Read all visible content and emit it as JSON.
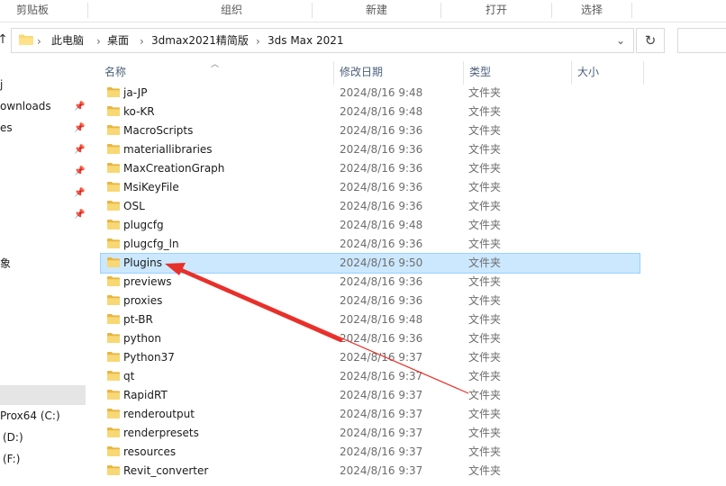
{
  "ribbon": {
    "groups": [
      "剪贴板",
      "组织",
      "新建",
      "打开",
      "选择"
    ]
  },
  "address": {
    "crumbs": [
      "此电脑",
      "桌面",
      "3dmax2021精简版",
      "3ds Max 2021"
    ],
    "dropdown_icon": "chevron-down-icon",
    "refresh_icon": "refresh-icon"
  },
  "nav": {
    "items": [
      {
        "label": "j",
        "pinned": false
      },
      {
        "label": "ownloads",
        "pinned": true
      },
      {
        "label": "es",
        "pinned": true
      },
      {
        "label": "",
        "pinned": true
      },
      {
        "label": "",
        "pinned": true
      },
      {
        "label": "",
        "pinned": true
      },
      {
        "label": "",
        "pinned": true
      },
      {
        "label": "象",
        "pinned": false
      },
      {
        "label": "Prox64 (C:)",
        "pinned": false
      },
      {
        "label": "(D:)",
        "pinned": false
      },
      {
        "label": "(F:)",
        "pinned": false
      }
    ]
  },
  "columns": {
    "name": "名称",
    "modified": "修改日期",
    "type": "类型",
    "size": "大小"
  },
  "files": [
    {
      "name": "ja-JP",
      "date": "2024/8/16 9:48",
      "type": "文件夹"
    },
    {
      "name": "ko-KR",
      "date": "2024/8/16 9:48",
      "type": "文件夹"
    },
    {
      "name": "MacroScripts",
      "date": "2024/8/16 9:36",
      "type": "文件夹"
    },
    {
      "name": "materiallibraries",
      "date": "2024/8/16 9:36",
      "type": "文件夹"
    },
    {
      "name": "MaxCreationGraph",
      "date": "2024/8/16 9:36",
      "type": "文件夹"
    },
    {
      "name": "MsiKeyFile",
      "date": "2024/8/16 9:36",
      "type": "文件夹"
    },
    {
      "name": "OSL",
      "date": "2024/8/16 9:36",
      "type": "文件夹"
    },
    {
      "name": "plugcfg",
      "date": "2024/8/16 9:48",
      "type": "文件夹"
    },
    {
      "name": "plugcfg_ln",
      "date": "2024/8/16 9:36",
      "type": "文件夹"
    },
    {
      "name": "Plugins",
      "date": "2024/8/16 9:50",
      "type": "文件夹",
      "selected": true
    },
    {
      "name": "previews",
      "date": "2024/8/16 9:36",
      "type": "文件夹"
    },
    {
      "name": "proxies",
      "date": "2024/8/16 9:36",
      "type": "文件夹"
    },
    {
      "name": "pt-BR",
      "date": "2024/8/16 9:48",
      "type": "文件夹"
    },
    {
      "name": "python",
      "date": "2024/8/16 9:36",
      "type": "文件夹"
    },
    {
      "name": "Python37",
      "date": "2024/8/16 9:37",
      "type": "文件夹"
    },
    {
      "name": "qt",
      "date": "2024/8/16 9:37",
      "type": "文件夹"
    },
    {
      "name": "RapidRT",
      "date": "2024/8/16 9:37",
      "type": "文件夹"
    },
    {
      "name": "renderoutput",
      "date": "2024/8/16 9:37",
      "type": "文件夹"
    },
    {
      "name": "renderpresets",
      "date": "2024/8/16 9:37",
      "type": "文件夹"
    },
    {
      "name": "resources",
      "date": "2024/8/16 9:37",
      "type": "文件夹"
    },
    {
      "name": "Revit_converter",
      "date": "2024/8/16 9:37",
      "type": "文件夹"
    }
  ],
  "colors": {
    "selection_fill": "#cce8ff",
    "selection_border": "#99d1ff",
    "folder_yellow": "#f8d775",
    "annotation_arrow": "#e8302a"
  }
}
